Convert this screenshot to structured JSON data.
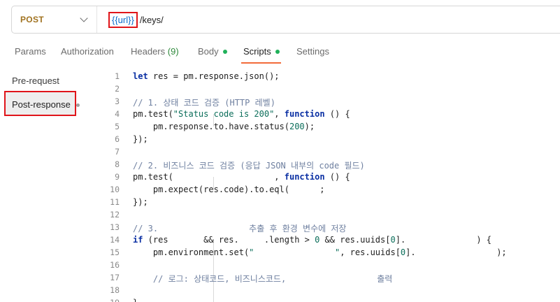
{
  "request": {
    "method": "POST",
    "url_variable": "{{url}}",
    "url_path": "/keys/"
  },
  "tabs": [
    {
      "label": "Params",
      "count": "",
      "has_dot": false,
      "active": false
    },
    {
      "label": "Authorization",
      "count": "",
      "has_dot": false,
      "active": false
    },
    {
      "label": "Headers",
      "count": "(9)",
      "has_dot": false,
      "active": false
    },
    {
      "label": "Body",
      "count": "",
      "has_dot": true,
      "active": false
    },
    {
      "label": "Scripts",
      "count": "",
      "has_dot": true,
      "active": true
    },
    {
      "label": "Settings",
      "count": "",
      "has_dot": false,
      "active": false
    }
  ],
  "scripts_sidebar": {
    "pre_request": "Pre-request",
    "post_response": "Post-response"
  },
  "editor": {
    "lines": [
      {
        "n": "1",
        "text": "let res = pm.response.json();"
      },
      {
        "n": "2",
        "text": ""
      },
      {
        "n": "3",
        "text": "// 1. 상태 코드 검증 (HTTP 레벨)"
      },
      {
        "n": "4",
        "text": "pm.test(\"Status code is 200\", function () {"
      },
      {
        "n": "5",
        "text": "    pm.response.to.have.status(200);"
      },
      {
        "n": "6",
        "text": "});"
      },
      {
        "n": "7",
        "text": ""
      },
      {
        "n": "8",
        "text": "// 2. 비즈니스 코드 검증 (응답 JSON 내부의 code 필드)"
      },
      {
        "n": "9",
        "text": "pm.test(                    , function () {"
      },
      {
        "n": "10",
        "text": "    pm.expect(res.code).to.eql(      ;"
      },
      {
        "n": "11",
        "text": "});"
      },
      {
        "n": "12",
        "text": ""
      },
      {
        "n": "13",
        "text": "// 3.                  추출 후 환경 변수에 저장"
      },
      {
        "n": "14",
        "text": "if (res       && res.     .length > 0 && res.uuids[0].              ) {"
      },
      {
        "n": "15",
        "text": "    pm.environment.set(\"                \", res.uuids[0].                );"
      },
      {
        "n": "16",
        "text": ""
      },
      {
        "n": "17",
        "text": "    // 로그: 상태코드, 비즈니스코드,                  출력"
      },
      {
        "n": "18",
        "text": ""
      },
      {
        "n": "19",
        "text": "}"
      }
    ]
  }
}
